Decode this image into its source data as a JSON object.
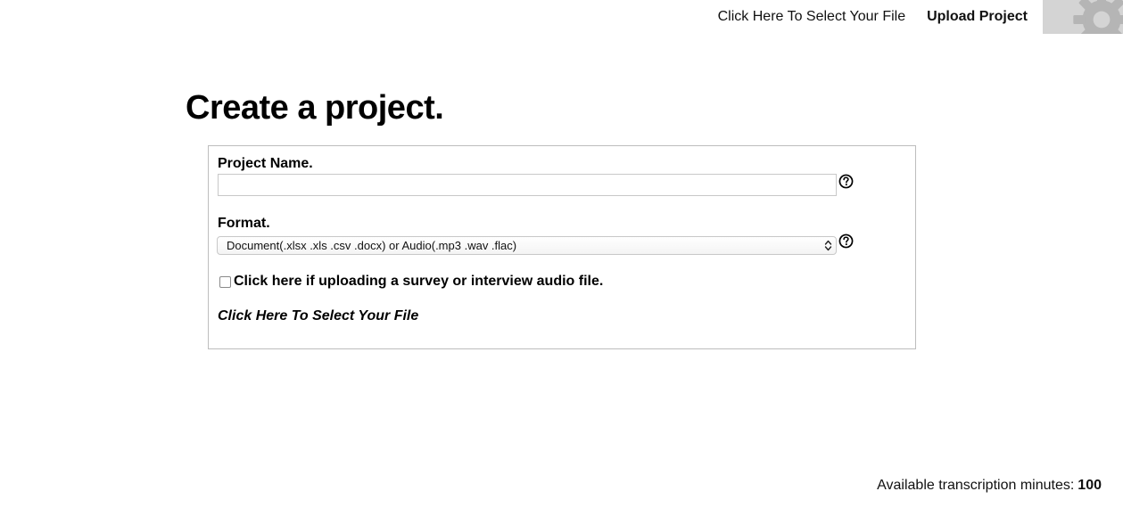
{
  "nav": {
    "select_file": "Click Here To Select Your File",
    "upload": "Upload Project",
    "settings_icon": "gear-icon"
  },
  "page": {
    "title": "Create a project."
  },
  "form": {
    "name_label": "Project Name.",
    "name_value": "",
    "format_label": "Format.",
    "format_selected": "Document(.xlsx .xls .csv .docx) or Audio(.mp3 .wav .flac)",
    "checkbox_label": "Click here if uploading a survey or interview audio file.",
    "checkbox_checked": false,
    "select_file": "Click Here To Select Your File",
    "help_icon": "question-circle-icon"
  },
  "footer": {
    "minutes_label": "Available transcription minutes:",
    "minutes_value": "100"
  },
  "colors": {
    "gear_background": "#d4d4d4",
    "gear_fill": "#b5b5b5",
    "panel_border": "#bdbdbd"
  }
}
